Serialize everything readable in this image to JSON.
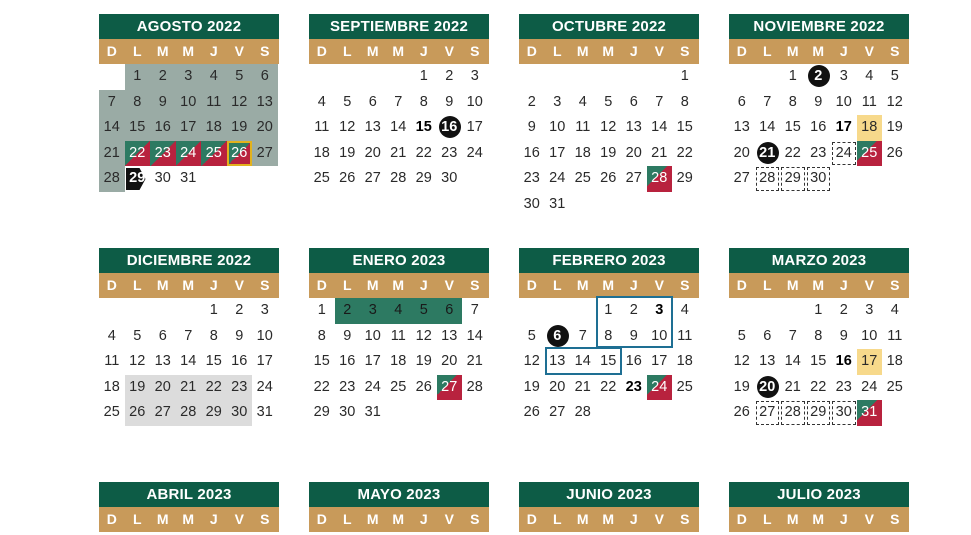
{
  "weekdays": [
    "D",
    "L",
    "M",
    "M",
    "J",
    "V",
    "S"
  ],
  "colors": {
    "header": "#0d5c46",
    "weekday_bar": "#c89a5a",
    "vacation": "#9aaba5",
    "green": "#2d7a62",
    "red": "#b8223e",
    "yellow": "#f7d98b"
  },
  "months": [
    {
      "title": "AGOSTO 2022",
      "offset": 1,
      "days": 31,
      "styles": {
        "1": "gray",
        "2": "gray",
        "3": "gray",
        "4": "gray",
        "5": "gray",
        "6": "gray",
        "7": "gray",
        "8": "gray",
        "9": "gray",
        "10": "gray",
        "11": "gray",
        "12": "gray",
        "13": "gray",
        "14": "gray",
        "15": "gray",
        "16": "gray",
        "17": "gray",
        "18": "gray",
        "19": "gray",
        "20": "gray",
        "21": "gray",
        "22": "mix",
        "23": "mix",
        "24": "mix",
        "25": "mix",
        "26": "mix outlined",
        "27": "gray",
        "28": "gray",
        "29": "arrow"
      }
    },
    {
      "title": "SEPTIEMBRE 2022",
      "offset": 4,
      "days": 30,
      "styles": {
        "15": "bold",
        "16": "circle"
      }
    },
    {
      "title": "OCTUBRE 2022",
      "offset": 6,
      "days": 31,
      "styles": {
        "28": "redmix"
      }
    },
    {
      "title": "NOVIEMBRE 2022",
      "offset": 2,
      "days": 30,
      "styles": {
        "2": "circle",
        "17": "bold",
        "18": "yellow",
        "21": "circle",
        "24": "dashed",
        "25": "redmix",
        "28": "dashed",
        "29": "dashed",
        "30": "dashed"
      }
    },
    {
      "title": "DICIEMBRE 2022",
      "offset": 4,
      "days": 31,
      "styles": {
        "19": "lgray",
        "20": "lgray",
        "21": "lgray",
        "22": "lgray",
        "23": "lgray",
        "26": "lgray",
        "27": "lgray",
        "28": "lgray",
        "29": "lgray",
        "30": "lgray"
      }
    },
    {
      "title": "ENERO 2023",
      "offset": 0,
      "days": 31,
      "styles": {
        "2": "green",
        "3": "green",
        "4": "green",
        "5": "green",
        "6": "green",
        "27": "redmix"
      }
    },
    {
      "title": "FEBRERO 2023",
      "offset": 3,
      "days": 28,
      "styles": {
        "3": "bold",
        "6": "circle",
        "23": "bold",
        "24": "redmix"
      }
    },
    {
      "title": "MARZO 2023",
      "offset": 3,
      "days": 31,
      "styles": {
        "16": "bold",
        "17": "yellow",
        "20": "circle",
        "27": "dashed",
        "28": "dashed",
        "29": "dashed",
        "30": "dashed",
        "31": "redmix"
      }
    },
    {
      "title": "ABRIL 2023",
      "offset": 6,
      "days": 0,
      "styles": {}
    },
    {
      "title": "MAYO 2023",
      "offset": 1,
      "days": 0,
      "styles": {}
    },
    {
      "title": "JUNIO 2023",
      "offset": 4,
      "days": 0,
      "styles": {}
    },
    {
      "title": "JULIO 2023",
      "offset": 6,
      "days": 0,
      "styles": {}
    }
  ]
}
